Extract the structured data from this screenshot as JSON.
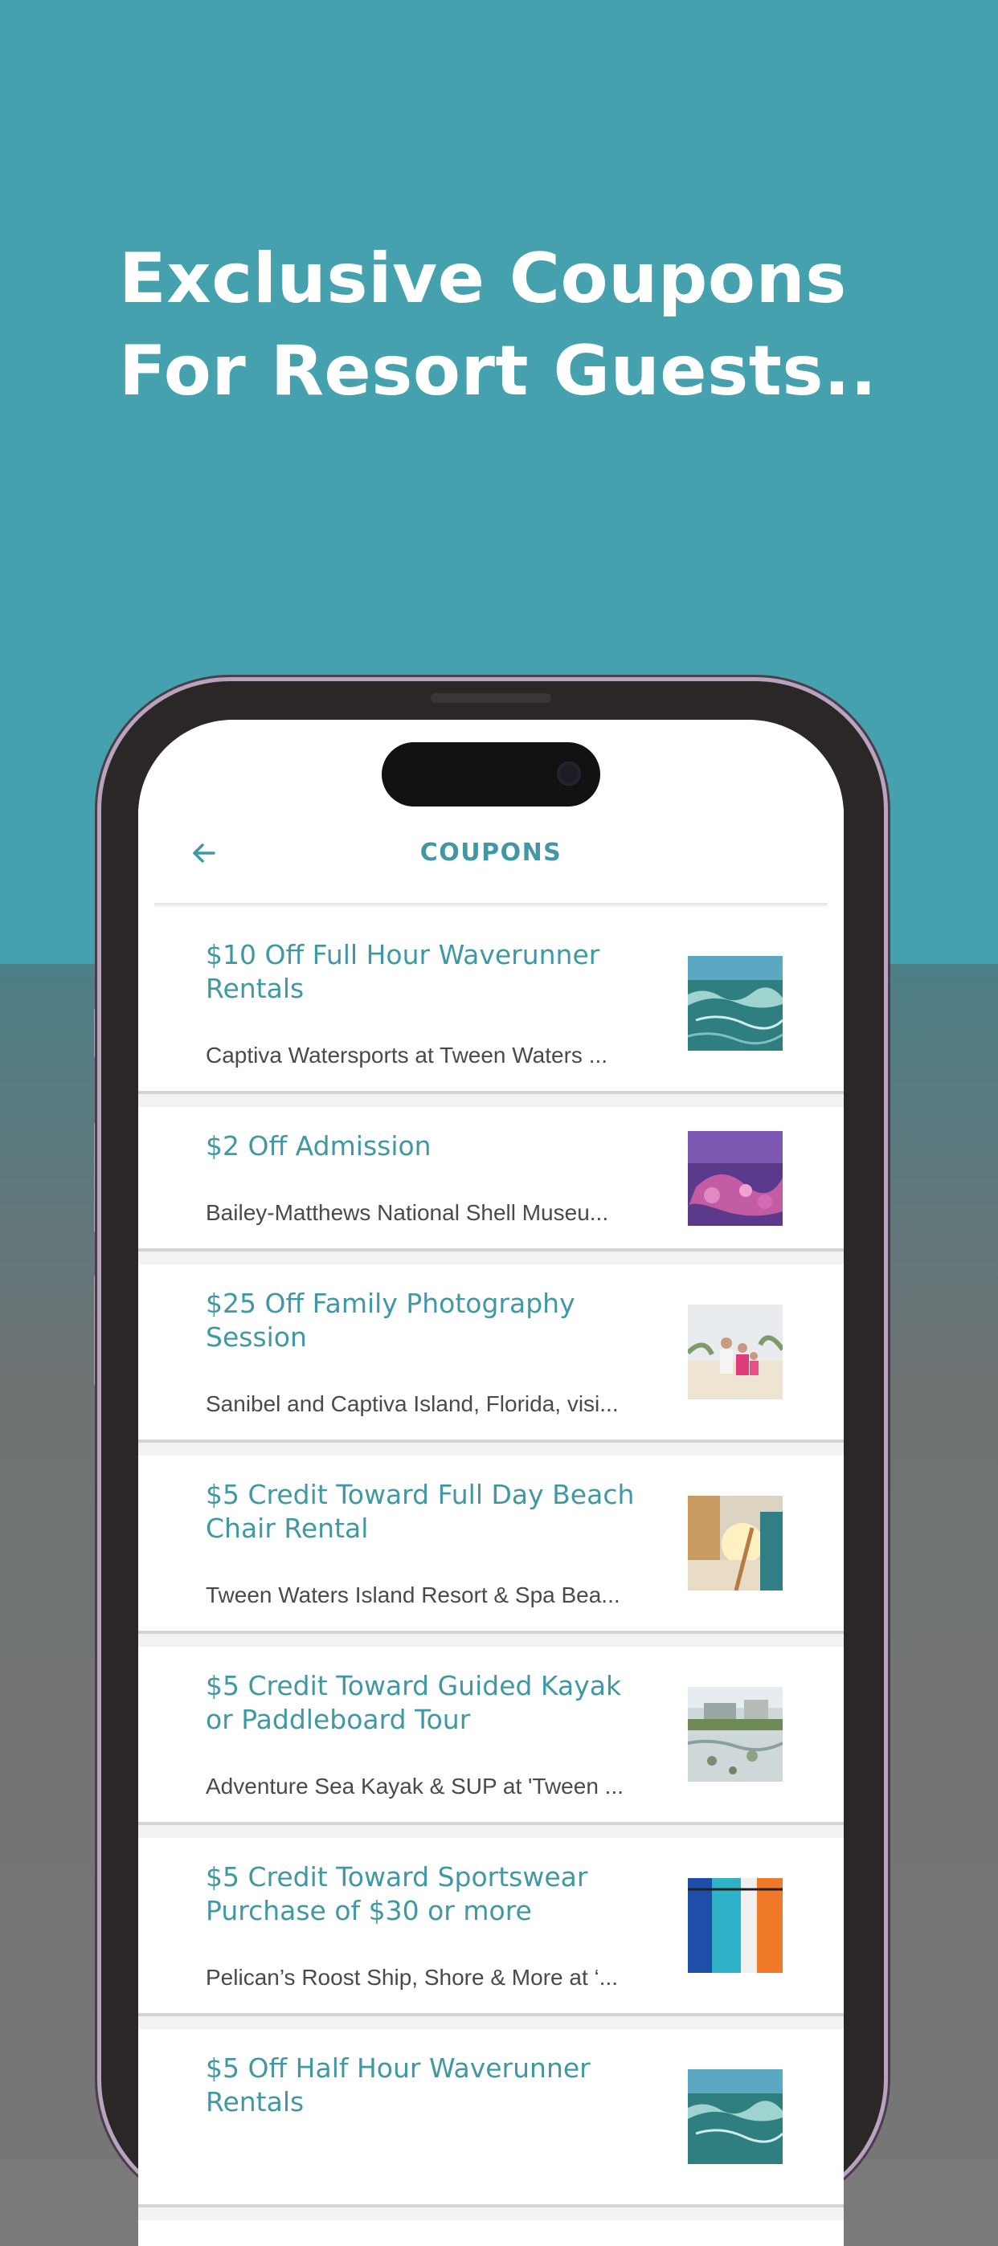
{
  "headline": {
    "line1": "Exclusive Coupons",
    "line2": "For Resort Guests.."
  },
  "appbar": {
    "back_icon": "arrow-left-icon",
    "title": "COUPONS"
  },
  "colors": {
    "teal_background": "#45a1ad",
    "accent_text": "#3f98a4",
    "phone_frame": "#2b2727"
  },
  "coupons": [
    {
      "title": "$10 Off Full Hour Waverunner Rentals",
      "subtitle": "Captiva Watersports at Tween Waters ...",
      "thumbnail": "ocean-waves-image"
    },
    {
      "title": "$2 Off Admission",
      "subtitle": "Bailey-Matthews National Shell Museu...",
      "thumbnail": "shell-coral-image"
    },
    {
      "title": "$25 Off Family Photography Session",
      "subtitle": "Sanibel and Captiva Island, Florida, visi...",
      "thumbnail": "family-beach-photo-image"
    },
    {
      "title": "$5 Credit Toward Full Day Beach Chair Rental",
      "subtitle": "Tween Waters Island Resort & Spa Bea...",
      "thumbnail": "beach-sunset-chairs-image"
    },
    {
      "title": "$5 Credit Toward Guided Kayak or Paddleboard Tour",
      "subtitle": "Adventure Sea Kayak & SUP at 'Tween ...",
      "thumbnail": "kayak-waterfront-image"
    },
    {
      "title": "$5 Credit Toward Sportswear Purchase of $30 or more",
      "subtitle": "Pelican’s Roost Ship, Shore & More at ‘...",
      "thumbnail": "shirts-rack-image"
    },
    {
      "title": "$5 Off Half Hour Waverunner Rentals",
      "subtitle": "",
      "thumbnail": "ocean-waves-image"
    }
  ]
}
